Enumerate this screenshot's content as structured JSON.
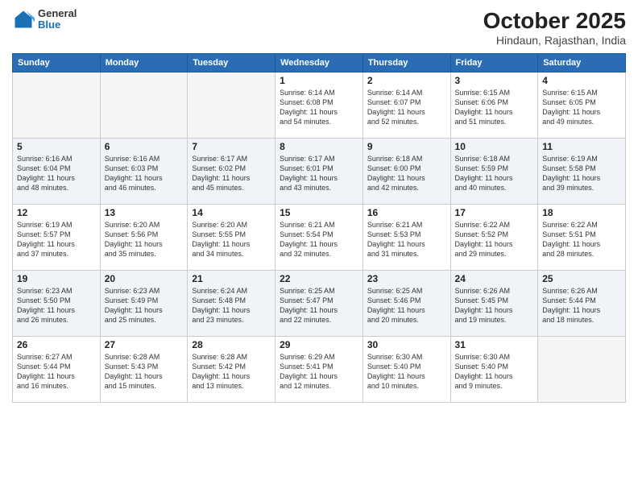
{
  "header": {
    "logo": {
      "general": "General",
      "blue": "Blue"
    },
    "title": "October 2025",
    "subtitle": "Hindaun, Rajasthan, India"
  },
  "weekdays": [
    "Sunday",
    "Monday",
    "Tuesday",
    "Wednesday",
    "Thursday",
    "Friday",
    "Saturday"
  ],
  "weeks": [
    [
      {
        "day": "",
        "info": ""
      },
      {
        "day": "",
        "info": ""
      },
      {
        "day": "",
        "info": ""
      },
      {
        "day": "1",
        "info": "Sunrise: 6:14 AM\nSunset: 6:08 PM\nDaylight: 11 hours\nand 54 minutes."
      },
      {
        "day": "2",
        "info": "Sunrise: 6:14 AM\nSunset: 6:07 PM\nDaylight: 11 hours\nand 52 minutes."
      },
      {
        "day": "3",
        "info": "Sunrise: 6:15 AM\nSunset: 6:06 PM\nDaylight: 11 hours\nand 51 minutes."
      },
      {
        "day": "4",
        "info": "Sunrise: 6:15 AM\nSunset: 6:05 PM\nDaylight: 11 hours\nand 49 minutes."
      }
    ],
    [
      {
        "day": "5",
        "info": "Sunrise: 6:16 AM\nSunset: 6:04 PM\nDaylight: 11 hours\nand 48 minutes."
      },
      {
        "day": "6",
        "info": "Sunrise: 6:16 AM\nSunset: 6:03 PM\nDaylight: 11 hours\nand 46 minutes."
      },
      {
        "day": "7",
        "info": "Sunrise: 6:17 AM\nSunset: 6:02 PM\nDaylight: 11 hours\nand 45 minutes."
      },
      {
        "day": "8",
        "info": "Sunrise: 6:17 AM\nSunset: 6:01 PM\nDaylight: 11 hours\nand 43 minutes."
      },
      {
        "day": "9",
        "info": "Sunrise: 6:18 AM\nSunset: 6:00 PM\nDaylight: 11 hours\nand 42 minutes."
      },
      {
        "day": "10",
        "info": "Sunrise: 6:18 AM\nSunset: 5:59 PM\nDaylight: 11 hours\nand 40 minutes."
      },
      {
        "day": "11",
        "info": "Sunrise: 6:19 AM\nSunset: 5:58 PM\nDaylight: 11 hours\nand 39 minutes."
      }
    ],
    [
      {
        "day": "12",
        "info": "Sunrise: 6:19 AM\nSunset: 5:57 PM\nDaylight: 11 hours\nand 37 minutes."
      },
      {
        "day": "13",
        "info": "Sunrise: 6:20 AM\nSunset: 5:56 PM\nDaylight: 11 hours\nand 35 minutes."
      },
      {
        "day": "14",
        "info": "Sunrise: 6:20 AM\nSunset: 5:55 PM\nDaylight: 11 hours\nand 34 minutes."
      },
      {
        "day": "15",
        "info": "Sunrise: 6:21 AM\nSunset: 5:54 PM\nDaylight: 11 hours\nand 32 minutes."
      },
      {
        "day": "16",
        "info": "Sunrise: 6:21 AM\nSunset: 5:53 PM\nDaylight: 11 hours\nand 31 minutes."
      },
      {
        "day": "17",
        "info": "Sunrise: 6:22 AM\nSunset: 5:52 PM\nDaylight: 11 hours\nand 29 minutes."
      },
      {
        "day": "18",
        "info": "Sunrise: 6:22 AM\nSunset: 5:51 PM\nDaylight: 11 hours\nand 28 minutes."
      }
    ],
    [
      {
        "day": "19",
        "info": "Sunrise: 6:23 AM\nSunset: 5:50 PM\nDaylight: 11 hours\nand 26 minutes."
      },
      {
        "day": "20",
        "info": "Sunrise: 6:23 AM\nSunset: 5:49 PM\nDaylight: 11 hours\nand 25 minutes."
      },
      {
        "day": "21",
        "info": "Sunrise: 6:24 AM\nSunset: 5:48 PM\nDaylight: 11 hours\nand 23 minutes."
      },
      {
        "day": "22",
        "info": "Sunrise: 6:25 AM\nSunset: 5:47 PM\nDaylight: 11 hours\nand 22 minutes."
      },
      {
        "day": "23",
        "info": "Sunrise: 6:25 AM\nSunset: 5:46 PM\nDaylight: 11 hours\nand 20 minutes."
      },
      {
        "day": "24",
        "info": "Sunrise: 6:26 AM\nSunset: 5:45 PM\nDaylight: 11 hours\nand 19 minutes."
      },
      {
        "day": "25",
        "info": "Sunrise: 6:26 AM\nSunset: 5:44 PM\nDaylight: 11 hours\nand 18 minutes."
      }
    ],
    [
      {
        "day": "26",
        "info": "Sunrise: 6:27 AM\nSunset: 5:44 PM\nDaylight: 11 hours\nand 16 minutes."
      },
      {
        "day": "27",
        "info": "Sunrise: 6:28 AM\nSunset: 5:43 PM\nDaylight: 11 hours\nand 15 minutes."
      },
      {
        "day": "28",
        "info": "Sunrise: 6:28 AM\nSunset: 5:42 PM\nDaylight: 11 hours\nand 13 minutes."
      },
      {
        "day": "29",
        "info": "Sunrise: 6:29 AM\nSunset: 5:41 PM\nDaylight: 11 hours\nand 12 minutes."
      },
      {
        "day": "30",
        "info": "Sunrise: 6:30 AM\nSunset: 5:40 PM\nDaylight: 11 hours\nand 10 minutes."
      },
      {
        "day": "31",
        "info": "Sunrise: 6:30 AM\nSunset: 5:40 PM\nDaylight: 11 hours\nand 9 minutes."
      },
      {
        "day": "",
        "info": ""
      }
    ]
  ]
}
